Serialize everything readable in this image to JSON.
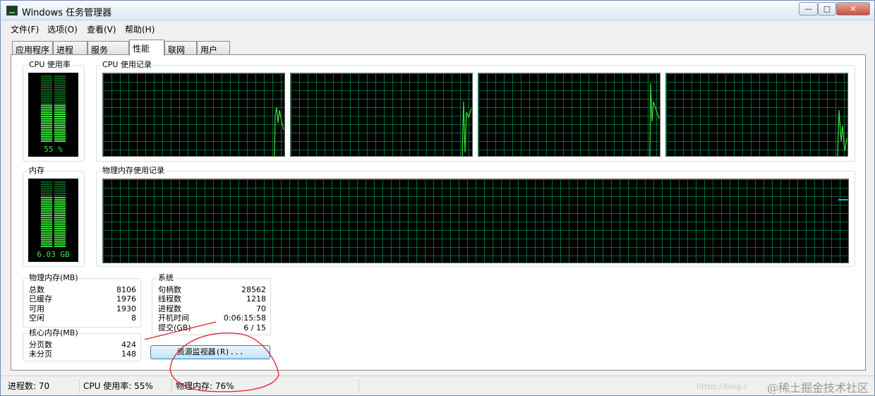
{
  "window": {
    "title": "Windows 任务管理器",
    "controls": {
      "minimize": "—",
      "maximize": "□",
      "close": "✕"
    }
  },
  "menu": [
    "文件(F)",
    "选项(O)",
    "查看(V)",
    "帮助(H)"
  ],
  "tabs": [
    "应用程序",
    "进程",
    "服务",
    "性能",
    "联网",
    "用户"
  ],
  "active_tab": "性能",
  "cpu": {
    "usage_label": "CPU 使用率",
    "value": "55 %",
    "level": 0.55,
    "history_label": "CPU 使用记录"
  },
  "memory": {
    "label": "内存",
    "value": "6.03 GB",
    "level": 0.76,
    "history_label": "物理内存使用记录"
  },
  "physical_memory": {
    "title": "物理内存(MB)",
    "rows": [
      {
        "key": "总数",
        "value": "8106"
      },
      {
        "key": "已缓存",
        "value": "1976"
      },
      {
        "key": "可用",
        "value": "1930"
      },
      {
        "key": "空闲",
        "value": "8"
      }
    ]
  },
  "kernel_memory": {
    "title": "核心内存(MB)",
    "rows": [
      {
        "key": "分页数",
        "value": "424"
      },
      {
        "key": "未分页",
        "value": "148"
      }
    ]
  },
  "system": {
    "title": "系统",
    "rows": [
      {
        "key": "句柄数",
        "value": "28562"
      },
      {
        "key": "线程数",
        "value": "1218"
      },
      {
        "key": "进程数",
        "value": "70"
      },
      {
        "key": "开机时间",
        "value": "0:06:15:58"
      },
      {
        "key": "提交(GB)",
        "value": "6 / 15"
      }
    ]
  },
  "resource_monitor_button": "资源监视器(R)...",
  "status": {
    "processes": "进程数: 70",
    "cpu": "CPU 使用率: 55%",
    "memory": "物理内存: 76%"
  },
  "watermark": {
    "url": "https://blog.c",
    "text": "@稀土掘金技术社区"
  },
  "colors": {
    "graph_line": "#39e339",
    "grid": "#008040",
    "annotation": "#e0202a"
  }
}
